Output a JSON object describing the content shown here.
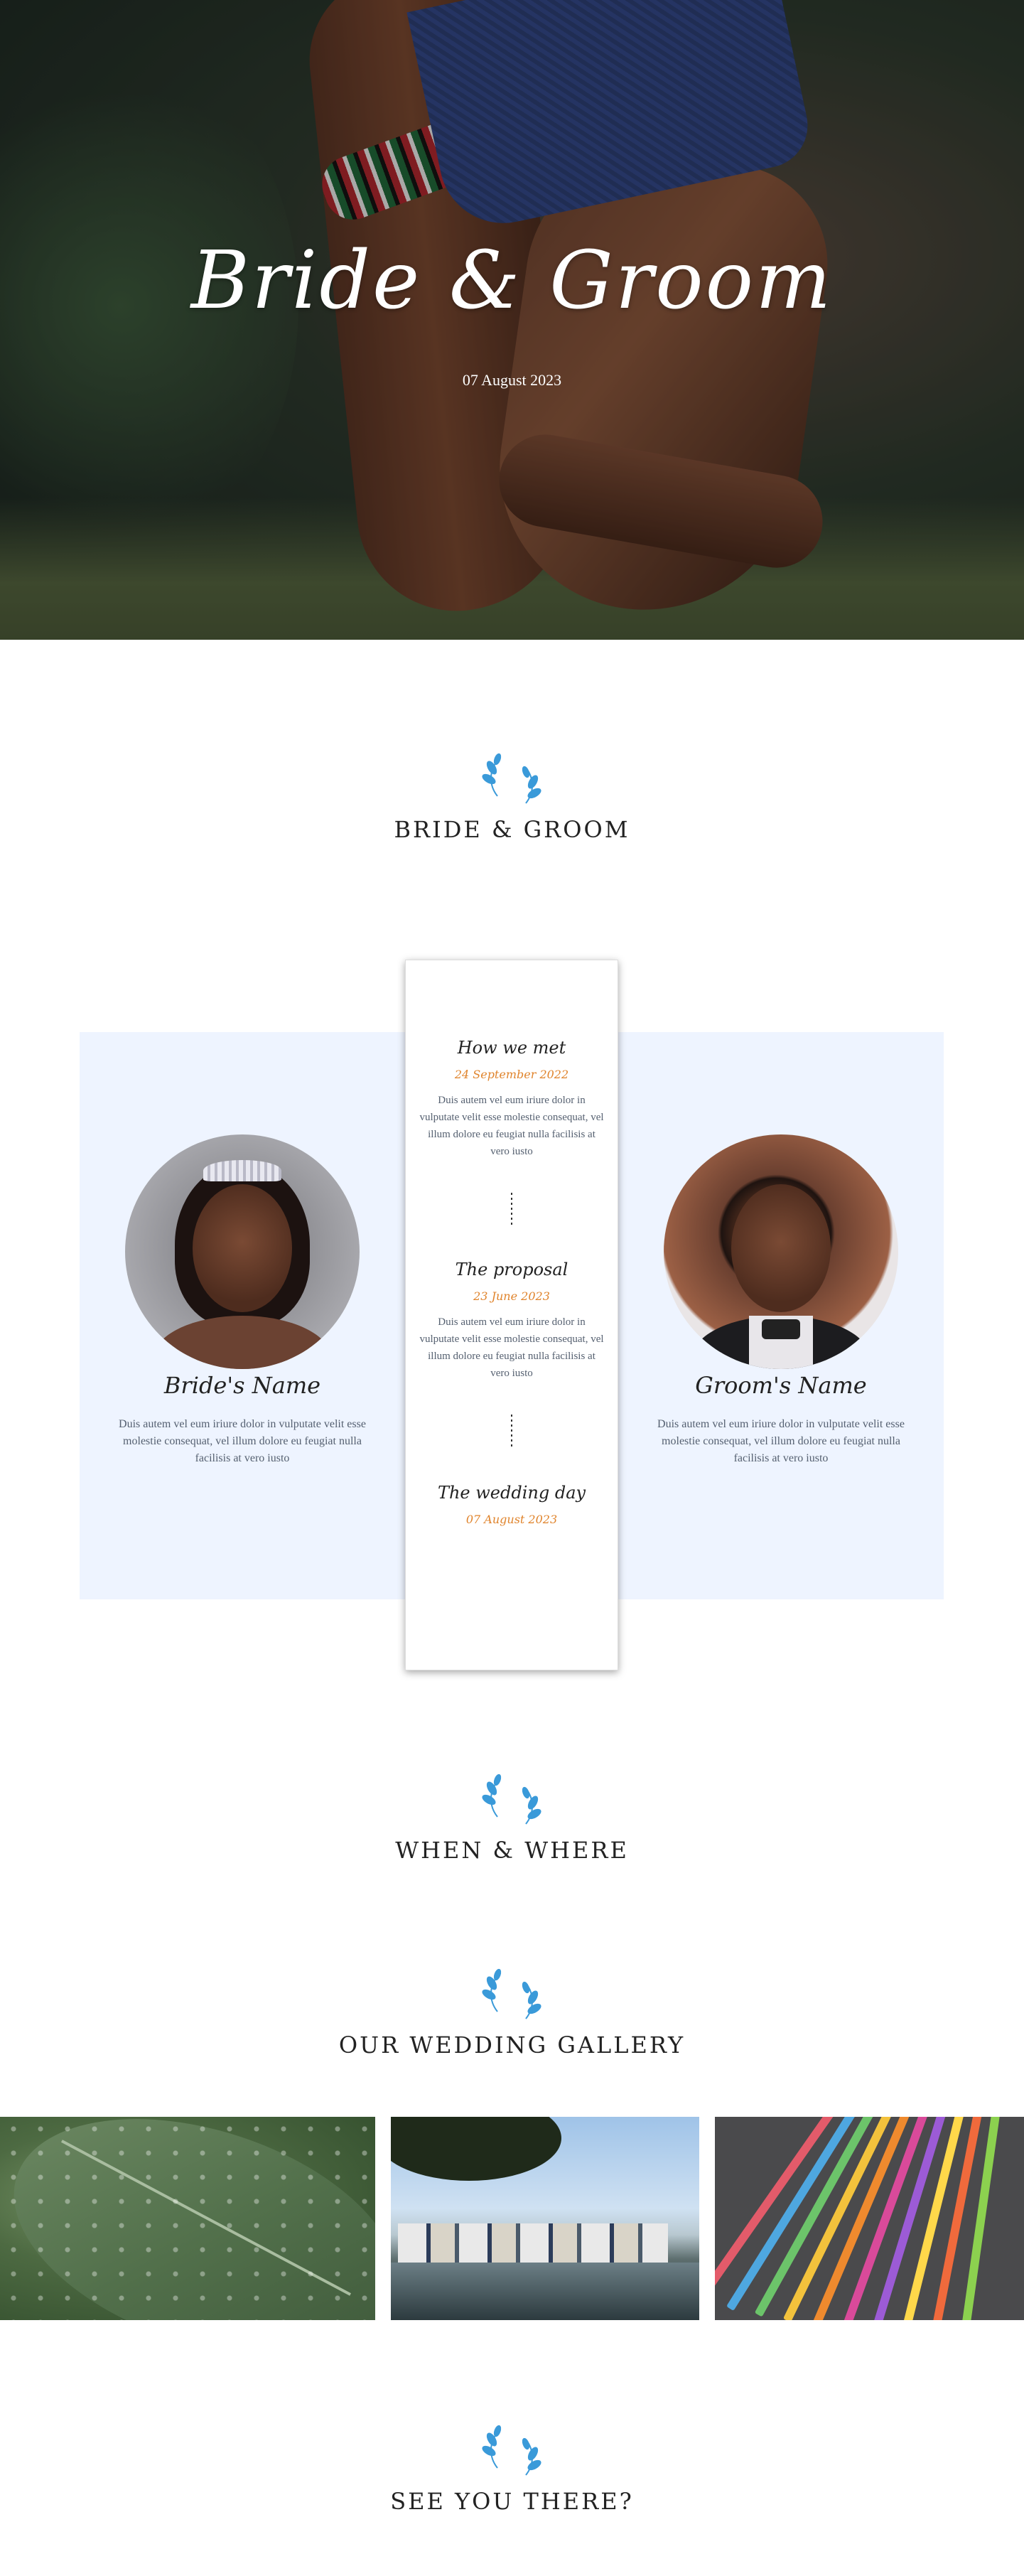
{
  "hero": {
    "title": "Bride & Groom",
    "date": "07 August 2023"
  },
  "sections": {
    "bride_groom": "BRIDE & GROOM",
    "when_where": "WHEN & WHERE",
    "gallery": "OUR WEDDING GALLERY",
    "see_you": "SEE YOU THERE?"
  },
  "bride": {
    "name": "Bride's Name",
    "text": "Duis autem vel eum iriure dolor in vulputate velit esse molestie consequat, vel illum dolore eu feugiat nulla facilisis at vero iusto"
  },
  "groom": {
    "name": "Groom's Name",
    "text": "Duis autem vel eum iriure dolor in vulputate velit esse molestie consequat, vel illum dolore eu feugiat nulla facilisis at vero iusto"
  },
  "timeline": [
    {
      "title": "How we met",
      "date": "24 September 2022",
      "text": "Duis autem vel eum iriure dolor in vulputate velit esse molestie consequat, vel illum dolore eu feugiat nulla facilisis at vero iusto"
    },
    {
      "title": "The proposal",
      "date": "23 June 2023",
      "text": "Duis autem vel eum iriure dolor in vulputate velit esse molestie consequat, vel illum dolore eu feugiat nulla facilisis at vero iusto"
    },
    {
      "title": "The wedding day",
      "date": "07 August 2023"
    }
  ],
  "colors": {
    "accent": "#e0842c",
    "panel": "#eef4ff",
    "laurel": "#3a9ad9"
  }
}
